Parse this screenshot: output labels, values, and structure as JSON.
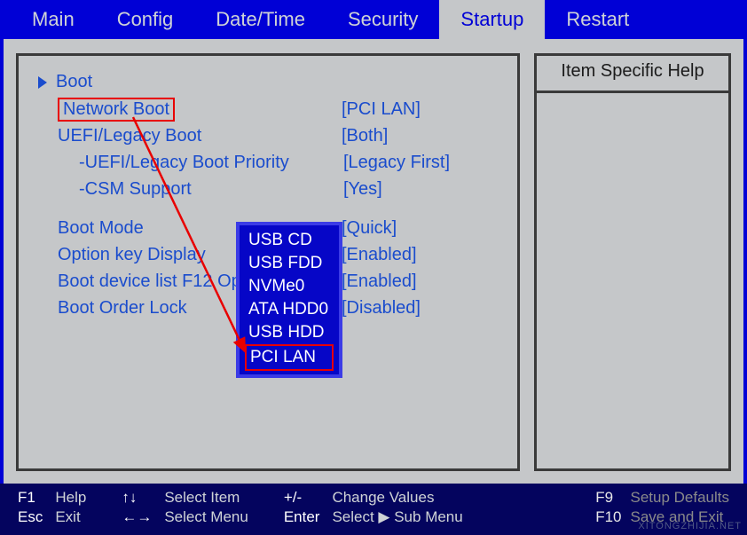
{
  "tabs": [
    "Main",
    "Config",
    "Date/Time",
    "Security",
    "Startup",
    "Restart"
  ],
  "active_tab_index": 4,
  "help_title": "Item Specific Help",
  "settings": {
    "boot_header": "Boot",
    "rows": [
      {
        "label": "Network Boot",
        "value": "[PCI LAN]",
        "indent": 1,
        "highlight_label": true
      },
      {
        "label": "UEFI/Legacy Boot",
        "value": "[Both]",
        "indent": 1
      },
      {
        "label": "-UEFI/Legacy Boot Priority",
        "value": "[Legacy First]",
        "indent": 2
      },
      {
        "label": "-CSM Support",
        "value": "[Yes]",
        "indent": 2
      },
      {
        "spacer": true
      },
      {
        "label": "Boot Mode",
        "value": "[Quick]",
        "indent": 1
      },
      {
        "label": "Option key Display",
        "value": "[Enabled]",
        "indent": 1
      },
      {
        "label": "Boot device list F12 Option",
        "value": "[Enabled]",
        "indent": 1
      },
      {
        "label": "Boot Order Lock",
        "value": "[Disabled]",
        "indent": 1
      }
    ]
  },
  "dropdown": {
    "items": [
      "USB CD",
      "USB FDD",
      "NVMe0",
      "ATA HDD0",
      "USB HDD",
      "PCI LAN"
    ],
    "selected_index": 5
  },
  "legend": {
    "col1": [
      [
        "F1",
        "Help"
      ],
      [
        "Esc",
        "Exit"
      ]
    ],
    "col2": [
      [
        "↑↓",
        "Select Item"
      ],
      [
        "←→",
        "Select Menu"
      ]
    ],
    "col3": [
      [
        "+/-",
        "Change Values"
      ],
      [
        "Enter",
        "Select ▶ Sub Menu"
      ]
    ],
    "col4": [
      [
        "F9",
        "Setup Defaults"
      ],
      [
        "F10",
        "Save and Exit"
      ]
    ]
  },
  "watermark": "XITONGZHIJIA.NET"
}
